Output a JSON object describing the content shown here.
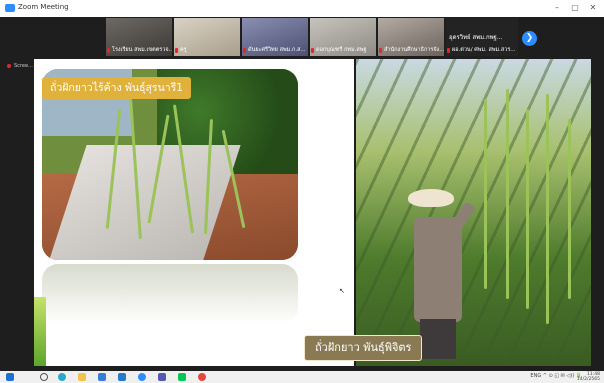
{
  "window": {
    "app_title": "Zoom Meeting",
    "controls": [
      "–",
      "▢",
      "✕"
    ]
  },
  "gallery": {
    "participants": [
      {
        "name": "โรงเรียน สพม.เขตตรวจ...",
        "mic_muted": true
      },
      {
        "name": "ครู",
        "mic_muted": true
      },
      {
        "name": "ดันยะศรีวิทย สพม.ก.ส...",
        "mic_muted": true
      },
      {
        "name": "ดอกบุณฑรี กทม.สพฐ",
        "mic_muted": true
      },
      {
        "name": "สำนักงานศึกษาธิการจัง...",
        "mic_muted": true
      },
      {
        "name": "ผอ.ต่วน/ ศพม. สพม.สวร...",
        "mic_muted": true
      }
    ],
    "overflow_label": "อุดรวิทย์ สพม.กพฐ...",
    "next_arrow": "❯"
  },
  "share_indicator": "Scree...",
  "slide": {
    "label_top": "ถั่วฝักยาวไร้ค้าง พันธุ์สุรนารี1",
    "label_bottom": "ถั่วฝักยาว พันธุ์พิจิตร"
  },
  "colors": {
    "accent": "#2d8cff",
    "label_gold": "#e0b23c",
    "label_brown": "#8a7a53",
    "mic_red": "#e02828"
  },
  "taskbar": {
    "icons": [
      "windows-start",
      "search",
      "edge",
      "explorer",
      "store",
      "mail",
      "zoom",
      "teams",
      "line",
      "chrome"
    ],
    "system_tray": "ENG ^ ⊙ ◱ ✉ ◁)) 🔋",
    "time": "11:48",
    "date": "14/2/2565"
  }
}
